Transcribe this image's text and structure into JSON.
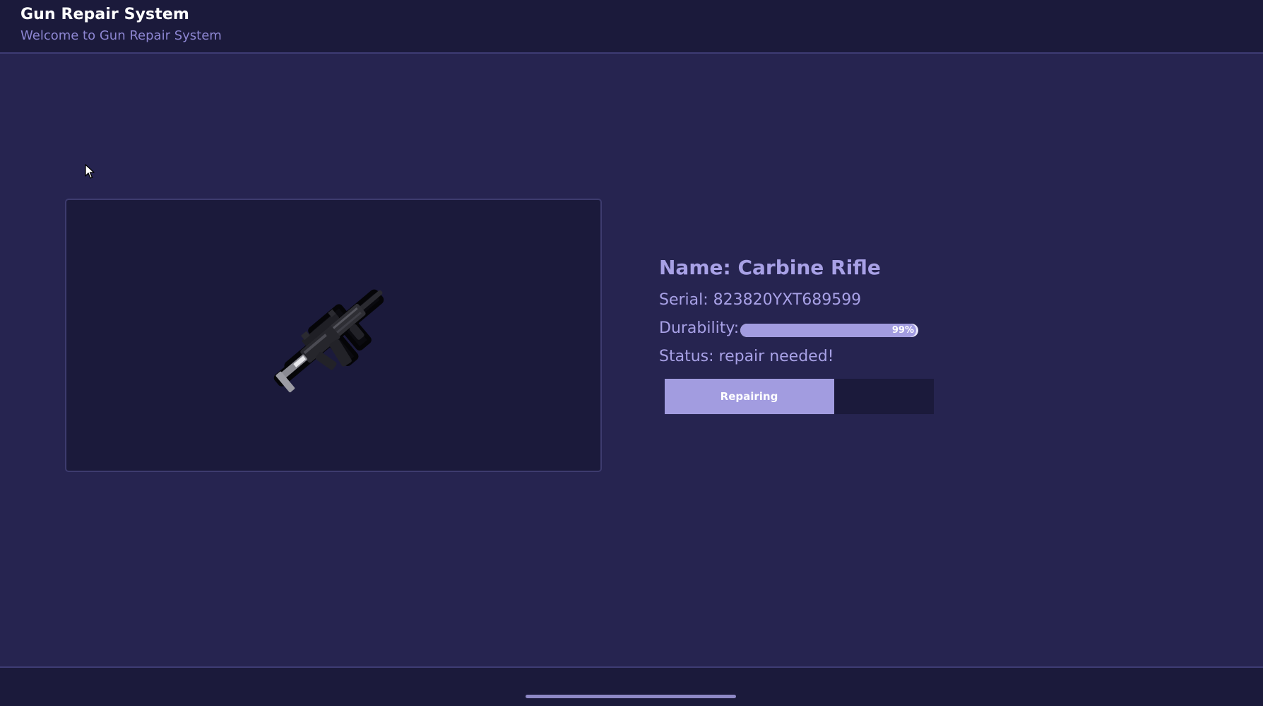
{
  "header": {
    "title": "Gun Repair System",
    "subtitle": "Welcome to Gun Repair System"
  },
  "weapon": {
    "image_icon": "rifle-icon",
    "name_line": "Name: Carbine Rifle",
    "serial_line": "Serial: 823820YXT689599",
    "durability_label": "Durability:",
    "durability_value": 0.99,
    "durability_text": "99%",
    "status_line": "Status: repair needed!"
  },
  "repair": {
    "label": "Repairing",
    "progress": 0.63
  },
  "colors": {
    "background": "#262450",
    "panel": "#1b1a3b",
    "accent": "#a29ce0",
    "text_accent": "#a8a1e6"
  }
}
